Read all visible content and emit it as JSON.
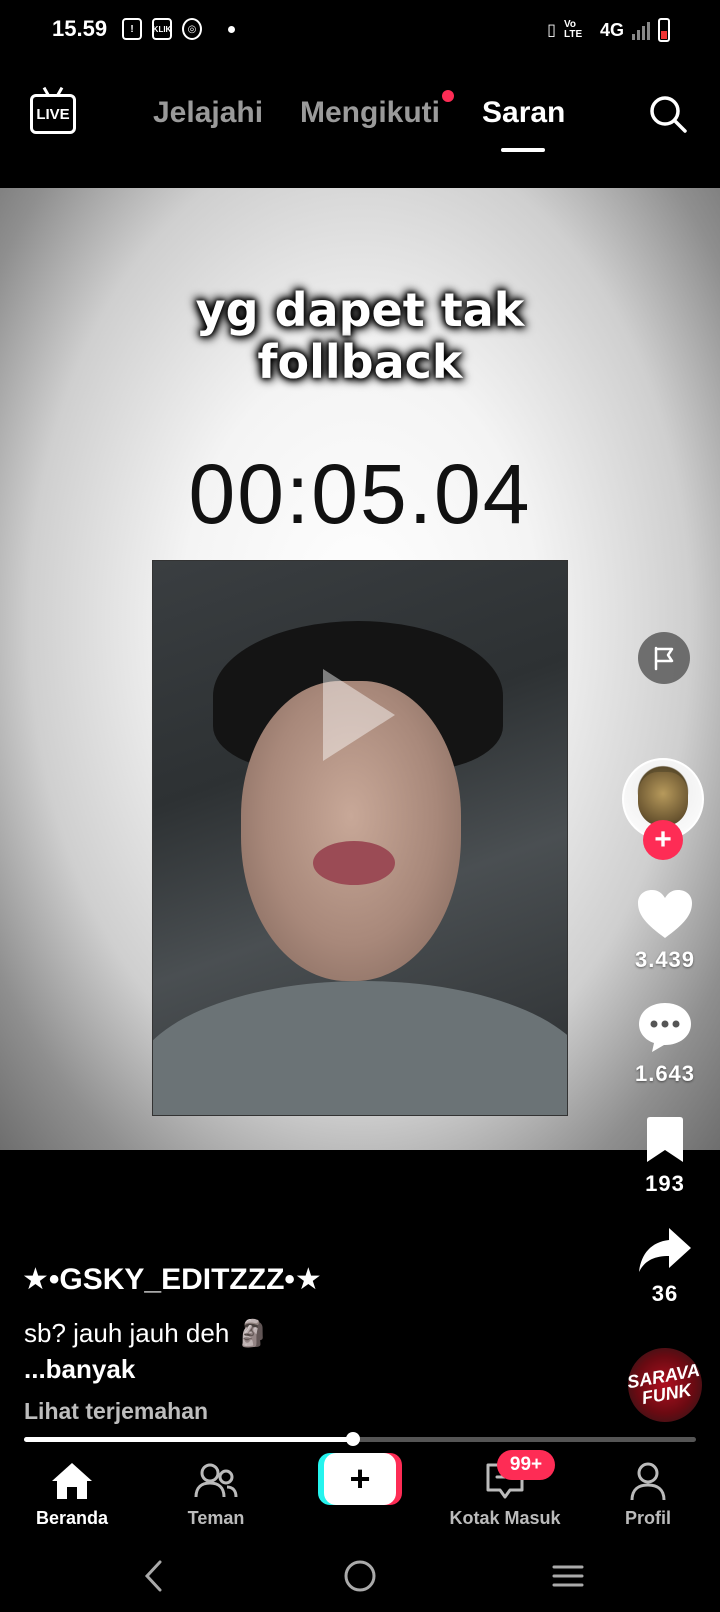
{
  "status_bar": {
    "time": "15.59",
    "network": "4G",
    "volte": "Vo LTE",
    "notif_icons": [
      "alert-icon",
      "klik-icon",
      "app-icon"
    ]
  },
  "top_nav": {
    "live_label": "LIVE",
    "tabs": [
      {
        "label": "Jelajahi",
        "active": false
      },
      {
        "label": "Mengikuti",
        "active": false,
        "has_dot": true
      },
      {
        "label": "Saran",
        "active": true
      }
    ]
  },
  "video": {
    "caption_line1": "yg dapet tak",
    "caption_line2": "follback",
    "timer": "00:05.04"
  },
  "right_rail": {
    "likes": "3.439",
    "comments": "1.643",
    "saves": "193",
    "shares": "36",
    "music_disc_text": "SARAVA FUNK"
  },
  "post": {
    "username": "★•GSKY_EDITZZZ•★",
    "description": "sb? jauh jauh deh 🗿",
    "more": "...banyak",
    "translate": "Lihat terjemahan",
    "progress": 0.49
  },
  "bottom_nav": {
    "items": [
      {
        "label": "Beranda",
        "icon": "home-icon",
        "active": true
      },
      {
        "label": "Teman",
        "icon": "friends-icon",
        "active": false
      },
      {
        "label": "Kotak Masuk",
        "icon": "inbox-icon",
        "active": false,
        "badge": "99+"
      },
      {
        "label": "Profil",
        "icon": "profile-icon",
        "active": false
      }
    ],
    "create_label": "+"
  },
  "colors": {
    "accent_red": "#fe2c55",
    "accent_cyan": "#25f4ee"
  }
}
